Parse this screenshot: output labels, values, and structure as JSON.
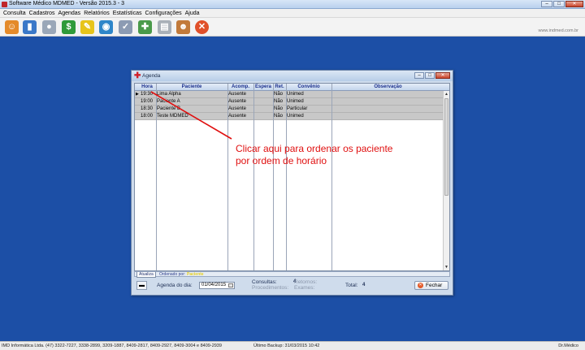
{
  "window": {
    "title": "Software Médico MDMED - Versão 2015.3 - 3",
    "controls": [
      "–",
      "□",
      "✕"
    ]
  },
  "menu": [
    "Consulta",
    "Cadastros",
    "Agendas",
    "Relatórios",
    "Estatísticas",
    "Configurações",
    "Ajuda"
  ],
  "toolbar": {
    "buttons": [
      {
        "icon": "user-icon",
        "color": "#e48a2a",
        "glyph": "☺"
      },
      {
        "icon": "document-icon",
        "color": "#3a78c8",
        "glyph": "▮"
      },
      {
        "icon": "pill-icon",
        "color": "#9aa7b8",
        "glyph": "●"
      },
      {
        "icon": "dollar-icon",
        "color": "#2f9a3a",
        "glyph": "$"
      },
      {
        "icon": "notes-icon",
        "color": "#e7c41a",
        "glyph": "✎"
      },
      {
        "icon": "globe-icon",
        "color": "#2f86c9",
        "glyph": "◉"
      },
      {
        "icon": "checklist-icon",
        "color": "#8c9bb3",
        "glyph": "✓"
      },
      {
        "icon": "edit-icon",
        "color": "#4a9a4a",
        "glyph": "✚"
      },
      {
        "icon": "printer-icon",
        "color": "#a9b0b8",
        "glyph": "▤"
      },
      {
        "icon": "doctor-icon",
        "color": "#c27a3a",
        "glyph": "☻"
      },
      {
        "icon": "exit-icon",
        "color": "#e0502a",
        "glyph": "✕"
      }
    ],
    "url": "www.indmed.com.br"
  },
  "agenda": {
    "title": "Agenda",
    "columns": [
      "Hora",
      "Paciente",
      "Acomp.",
      "Espera",
      "Ret.",
      "Convênio",
      "Observação"
    ],
    "rows": [
      {
        "hora": "19:30",
        "paciente": "Lima Alpha",
        "acomp": "Ausente",
        "espera": "",
        "ret": "Não",
        "convenio": "Unimed",
        "obs": ""
      },
      {
        "hora": "19:00",
        "paciente": "Paciente A",
        "acomp": "Ausente",
        "espera": "",
        "ret": "Não",
        "convenio": "Unimed",
        "obs": ""
      },
      {
        "hora": "18:30",
        "paciente": "Paciente B",
        "acomp": "Ausente",
        "espera": "",
        "ret": "Não",
        "convenio": "Particular",
        "obs": ""
      },
      {
        "hora": "18:00",
        "paciente": "Teste MDMED",
        "acomp": "Ausente",
        "espera": "",
        "ret": "Não",
        "convenio": "Unimed",
        "obs": ""
      }
    ],
    "tab_label": "Atualiza",
    "ordering_label": "Ordenado por:",
    "ordering_value": "Paciente",
    "date_label": "Agenda do dia:",
    "date_value": "01/04/2015",
    "consultas_label": "Consultas:",
    "consultas_value": "4",
    "procedimentos_label": "Procedimentos:",
    "retornos_label": "Retornos:",
    "exames_label": "Exames:",
    "total_label": "Total:",
    "total_value": "4",
    "close_label": "Fechar"
  },
  "annotation": {
    "line1": "Clicar aqui para ordenar os paciente",
    "line2": "por ordem de horário",
    "color": "#e01010"
  },
  "status": {
    "company": "IMD Informática Ltda. (47) 3322-7227, 3338-2899, 3209-1887, 8409-2817, 8409-2927, 8409-3004 e 8409-2939",
    "backup": "Último Backup: 31/03/2015 10:42",
    "user": "Dr.Médico"
  }
}
